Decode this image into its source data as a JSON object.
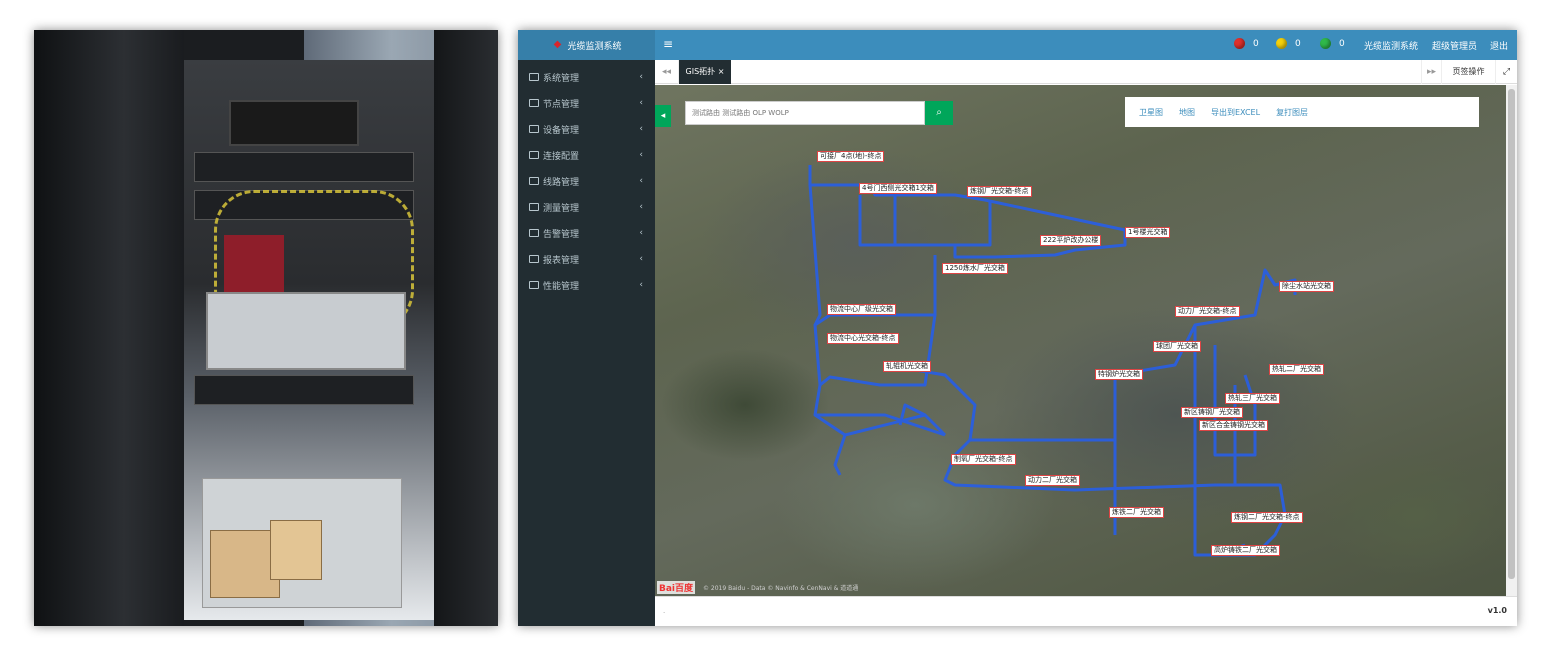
{
  "app": {
    "title": "光缆监测系统",
    "menu_icon": "≡",
    "alarms": [
      {
        "color": "#e0302b",
        "count": "0"
      },
      {
        "color": "#f5d10c",
        "count": "0"
      },
      {
        "color": "#2fb84a",
        "count": "0"
      }
    ],
    "system_link": "光缆监测系统",
    "user_link": "超级管理员",
    "logout_link": "退出"
  },
  "sidebar": {
    "items": [
      {
        "label": "系统管理"
      },
      {
        "label": "节点管理"
      },
      {
        "label": "设备管理"
      },
      {
        "label": "连接配置"
      },
      {
        "label": "线路管理"
      },
      {
        "label": "测量管理"
      },
      {
        "label": "告警管理"
      },
      {
        "label": "报表管理"
      },
      {
        "label": "性能管理"
      }
    ],
    "chevron": "‹"
  },
  "tabs": {
    "prev": "◂◂",
    "active": "GIS拓扑 ×",
    "next": "▸▸",
    "ops": "页签操作",
    "fullscreen": "⤢"
  },
  "map": {
    "toggle": "◂",
    "search_placeholder": "测试路由 测试路由 OLP WOLP",
    "search_icon": "⌕",
    "tools": [
      "卫星图",
      "地图",
      "导出到EXCEL",
      "复打图层"
    ],
    "labels": [
      "可接厂4点(地)-终点",
      "4号门西侧光交箱1交箱",
      "炼钢厂光交箱-终点",
      "222平炉改办公楼",
      "1号楼光交箱",
      "1250炼水厂光交箱",
      "物流中心厂级光交箱",
      "物流中心光交箱-终点",
      "轧辊机光交箱",
      "除尘水站光交箱",
      "动力厂光交箱-终点",
      "球团厂光交箱",
      "热轧二厂光交箱",
      "特钢炉光交箱",
      "热轧三厂光交箱",
      "新区铸钢厂光交箱",
      "新区合金铸钢光交箱",
      "制氧厂光交箱-终点",
      "动力二厂光交箱",
      "炼铁二厂光交箱",
      "炼钢二厂光交箱-终点",
      "高炉铸铁二厂光交箱"
    ],
    "baidu_logo": "Bai百度",
    "copyright": "© 2019 Baidu - Data © Navinfo & CenNavi & 道道通"
  },
  "footer": {
    "dot": "·",
    "version": "v1.0"
  }
}
